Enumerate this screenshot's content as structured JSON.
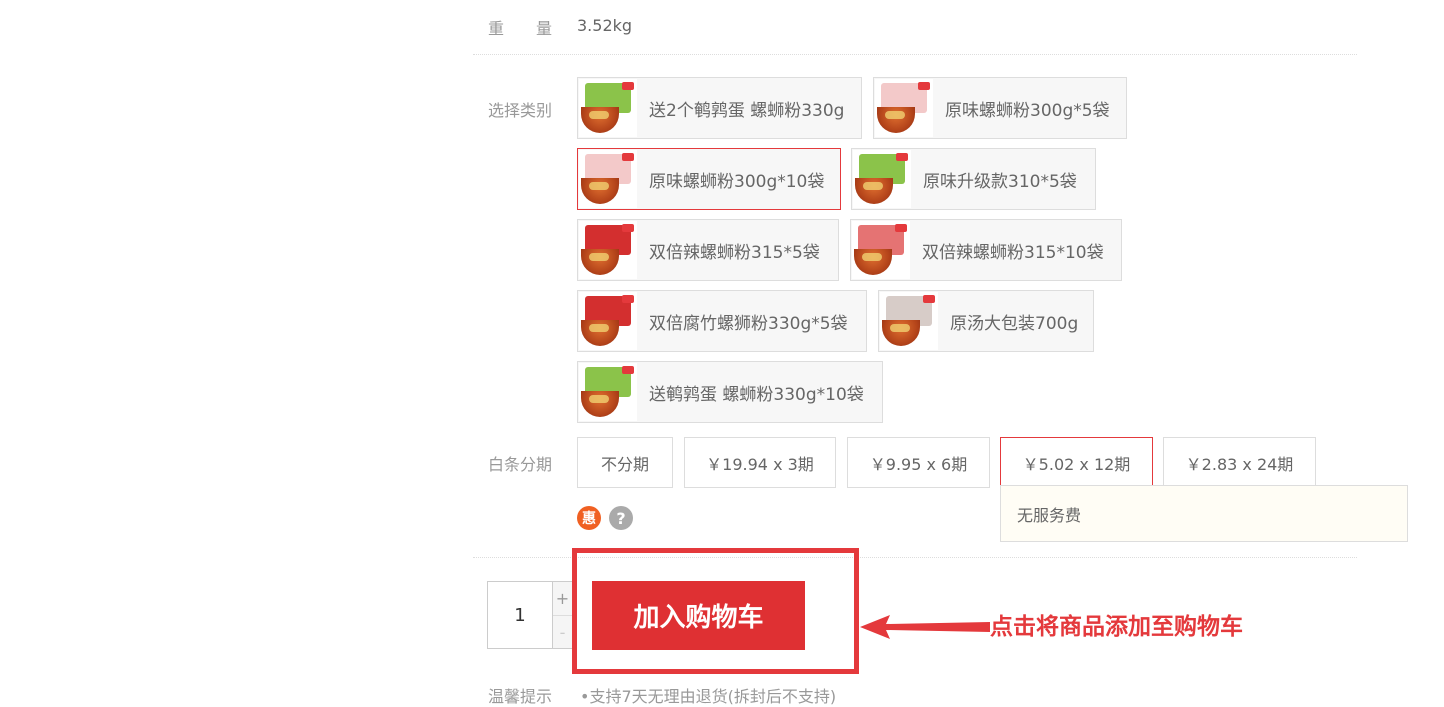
{
  "weight": {
    "label": "重　　量",
    "value": "3.52kg"
  },
  "variants": {
    "label": "选择类别",
    "items": [
      {
        "text": "送2个鹌鹑蛋 螺蛳粉330g",
        "selected": false,
        "pack_color": "#8bc34a"
      },
      {
        "text": "原味螺蛳粉300g*5袋",
        "selected": false,
        "pack_color": "#f3c9c9"
      },
      {
        "text": "原味螺蛳粉300g*10袋",
        "selected": true,
        "pack_color": "#f3c9c9"
      },
      {
        "text": "原味升级款310*5袋",
        "selected": false,
        "pack_color": "#8bc34a"
      },
      {
        "text": "双倍辣螺蛳粉315*5袋",
        "selected": false,
        "pack_color": "#d32f2f"
      },
      {
        "text": "双倍辣螺蛳粉315*10袋",
        "selected": false,
        "pack_color": "#e57373"
      },
      {
        "text": "双倍腐竹螺狮粉330g*5袋",
        "selected": false,
        "pack_color": "#d32f2f"
      },
      {
        "text": "原汤大包装700g",
        "selected": false,
        "pack_color": "#d7ccc8"
      },
      {
        "text": "送鹌鹑蛋 螺蛳粉330g*10袋",
        "selected": false,
        "pack_color": "#8bc34a"
      }
    ]
  },
  "installments": {
    "label": "白条分期",
    "options": [
      "不分期",
      "￥19.94 x 3期",
      "￥9.95 x 6期",
      "￥5.02 x 12期",
      "￥2.83 x 24期"
    ],
    "selected_index": 3,
    "tooltip": "无服务费",
    "hui_icon": "惠",
    "help_icon": "?"
  },
  "quantity": {
    "value": "1",
    "plus": "+",
    "minus": "-"
  },
  "cart": {
    "button_label": "加入购物车"
  },
  "annotation": {
    "text": "点击将商品添加至购物车",
    "color": "#e4393c"
  },
  "tips": {
    "label": "温馨提示",
    "text": "•支持7天无理由退货(拆封后不支持)"
  }
}
